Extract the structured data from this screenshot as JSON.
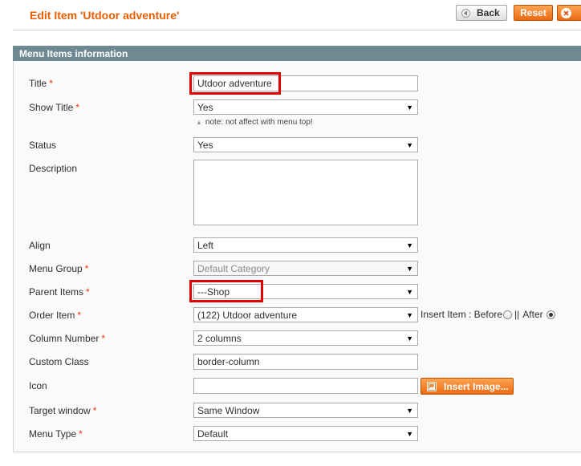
{
  "header": {
    "title": "Edit Item 'Utdoor adventure'",
    "back_label": "Back",
    "reset_label": "Reset"
  },
  "section": {
    "title": "Menu Items information"
  },
  "fields": {
    "title": {
      "label": "Title",
      "required": "*",
      "value": "Utdoor adventure"
    },
    "show_title": {
      "label": "Show Title",
      "required": "*",
      "value": "Yes",
      "note": "note: not affect with menu top!"
    },
    "status": {
      "label": "Status",
      "value": "Yes"
    },
    "description": {
      "label": "Description",
      "value": ""
    },
    "align": {
      "label": "Align",
      "value": "Left"
    },
    "menu_group": {
      "label": "Menu Group",
      "required": "*",
      "value": "Default Category"
    },
    "parent_items": {
      "label": "Parent Items",
      "required": "*",
      "value": "---Shop"
    },
    "order_item": {
      "label": "Order Item",
      "required": "*",
      "value": "(122) Utdoor adventure",
      "insert_label": "Insert Item : Before",
      "separator": "||",
      "after_label": "After",
      "selected": "After"
    },
    "column_number": {
      "label": "Column Number",
      "required": "*",
      "value": "2 columns"
    },
    "custom_class": {
      "label": "Custom Class",
      "value": "border-column"
    },
    "icon": {
      "label": "Icon",
      "value": "",
      "button_label": "Insert Image..."
    },
    "target_window": {
      "label": "Target window",
      "required": "*",
      "value": "Same Window"
    },
    "menu_type": {
      "label": "Menu Type",
      "required": "*",
      "value": "Default"
    }
  },
  "icons": {
    "back": "back-arrow-icon",
    "delete": "delete-x-icon",
    "dropdown": "dropdown-arrow-icon",
    "note": "triangle-up-icon",
    "insert_image": "image-icon"
  },
  "colors": {
    "title": "#eb5e00",
    "section_header": "#6f8992",
    "accent_button": "#ec6a14",
    "required": "#eb340a",
    "highlight": "#e00000"
  }
}
